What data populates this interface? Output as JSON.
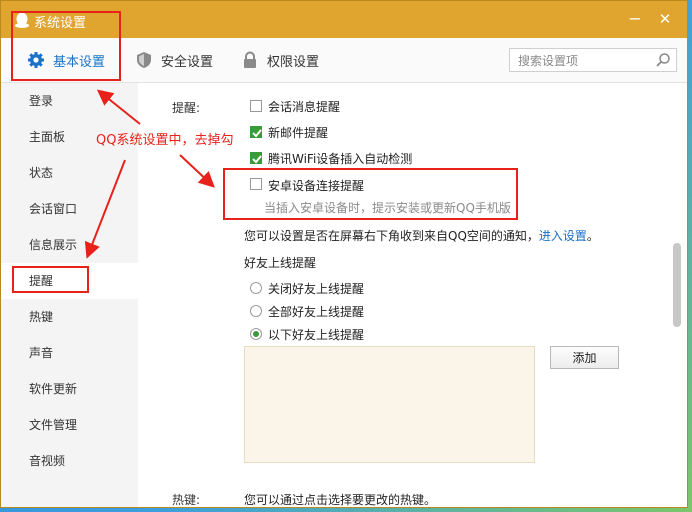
{
  "window": {
    "title": "系统设置",
    "minimize_glyph": "−",
    "close_glyph": "✕"
  },
  "tabs": [
    {
      "label": "基本设置",
      "icon": "gear-icon",
      "active": true
    },
    {
      "label": "安全设置",
      "icon": "shield-icon",
      "active": false
    },
    {
      "label": "权限设置",
      "icon": "lock-icon",
      "active": false
    }
  ],
  "search": {
    "placeholder": "搜索设置项",
    "icon": "search-icon"
  },
  "sidebar": {
    "items": [
      {
        "label": "登录"
      },
      {
        "label": "主面板"
      },
      {
        "label": "状态"
      },
      {
        "label": "会话窗口"
      },
      {
        "label": "信息展示"
      },
      {
        "label": "提醒",
        "active": true
      },
      {
        "label": "热键"
      },
      {
        "label": "声音"
      },
      {
        "label": "软件更新"
      },
      {
        "label": "文件管理"
      },
      {
        "label": "音视频"
      }
    ]
  },
  "content": {
    "reminder_label": "提醒:",
    "checkboxes": [
      {
        "label": "会话消息提醒",
        "checked": false
      },
      {
        "label": "新邮件提醒",
        "checked": true
      },
      {
        "label": "腾讯WiFi设备插入自动检测",
        "checked": true
      },
      {
        "label": "安卓设备连接提醒",
        "checked": false
      }
    ],
    "android_hint": "当插入安卓设备时，提示安装或更新QQ手机版",
    "qzone_notice": "您可以设置是否在屏幕右下角收到来自QQ空间的通知，",
    "qzone_link": "进入设置",
    "qzone_period": "。",
    "friend_online_title": "好友上线提醒",
    "radios": [
      {
        "label": "关闭好友上线提醒",
        "selected": false
      },
      {
        "label": "全部好友上线提醒",
        "selected": false
      },
      {
        "label": "以下好友上线提醒",
        "selected": true
      }
    ],
    "add_button": "添加",
    "hotkey_label": "热键:",
    "hotkey_desc": "您可以通过点击选择要更改的热键。"
  },
  "annotation": {
    "text": "QQ系统设置中，去掉勾",
    "color": "#e8221b"
  },
  "colors": {
    "titlebar": "#e0a52e",
    "accent": "#1a73c9",
    "check_green": "#3a9b3a",
    "annotation_red": "#e8221b"
  }
}
